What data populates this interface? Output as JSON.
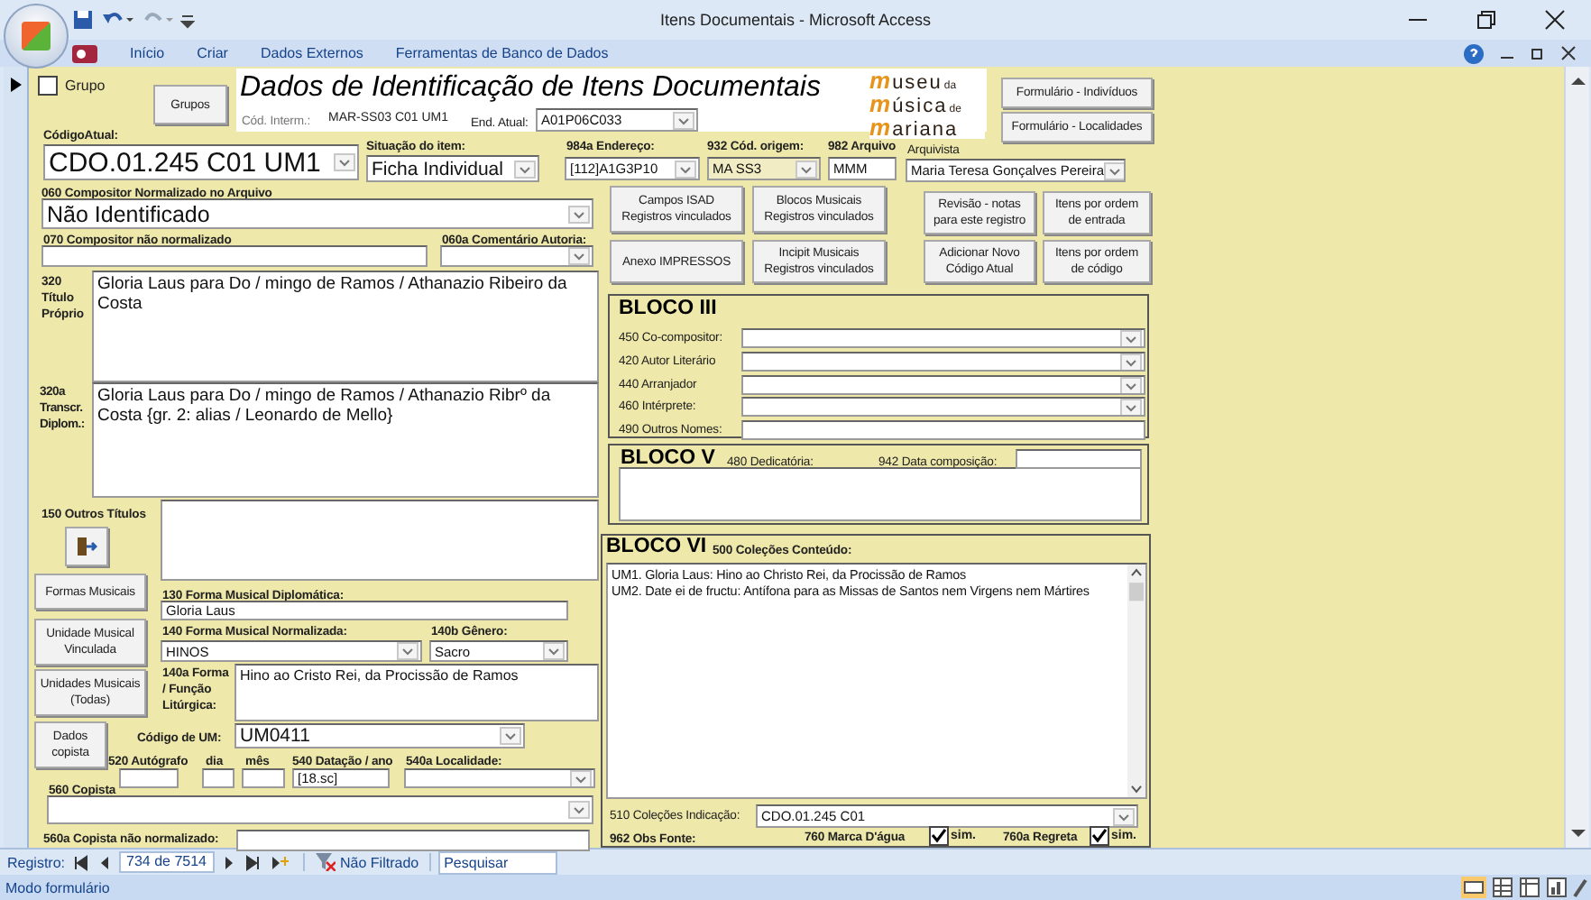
{
  "window": {
    "title": "Itens Documentais - Microsoft Access"
  },
  "ribbon_tabs": [
    "Início",
    "Criar",
    "Dados Externos",
    "Ferramentas de Banco de Dados"
  ],
  "form": {
    "title": "Dados de Identificação de Itens Documentais",
    "grupo": {
      "label": "Grupo",
      "checked": false
    },
    "logo": [
      {
        "word": "museu",
        "small": "da"
      },
      {
        "word": "música",
        "small": "de"
      },
      {
        "word": "mariana"
      }
    ],
    "buttons": [
      "Grupos",
      "Formulário - Indivíduos",
      "Formulário - Localidades",
      "Campos ISAD Registros vinculados",
      "Blocos Musicais Registros vinculados",
      "Anexo IMPRESSOS",
      "Incipit Musicais Registros vinculados",
      "Revisão - notas para este registro",
      "Itens por ordem de entrada",
      "Adicionar Novo Código Atual",
      "Itens por ordem de código",
      "Formas Musicais",
      "Unidade Musical Vinculada",
      "Unidades Musicais (Todas)",
      "Dados copista"
    ],
    "blocks": [
      "BLOCO III",
      "BLOCO V",
      "BLOCO VI"
    ],
    "fields": [
      {
        "label": "CódigoAtual:",
        "kind": "combo",
        "value": "CDO.01.245 C01 UM1"
      },
      {
        "label": "Situação do item:",
        "kind": "combo",
        "value": "Ficha Individual"
      },
      {
        "label": "984a Endereço:",
        "kind": "combo",
        "value": "[112]A1G3P10"
      },
      {
        "label": "932 Cód. origem:",
        "kind": "combo",
        "value": "MA SS3"
      },
      {
        "label": "982 Arquivo",
        "kind": "text",
        "value": "MMM"
      },
      {
        "label": "Arquivista",
        "kind": "combo",
        "value": "Maria Teresa Gonçalves Pereira"
      },
      {
        "label": "060 Compositor Normalizado no Arquivo",
        "kind": "combo",
        "value": "Não Identificado"
      },
      {
        "label": "070 Compositor não normalizado",
        "kind": "text"
      },
      {
        "label": "060a Comentário Autoria:",
        "kind": "combo"
      },
      {
        "label": "320 Título Próprio",
        "kind": "textarea",
        "value": "Gloria Laus para Do / mingo de Ramos / Athanazio Ribeiro da Costa"
      },
      {
        "label": "320a Transcr. Diplom.:",
        "kind": "textarea",
        "value": "Gloria Laus para Do / mingo de Ramos / Athanazio Ribrº da Costa {gr. 2: alias / Leonardo de Mello}"
      },
      {
        "label": "150 Outros Títulos",
        "kind": "textarea"
      },
      {
        "label": "130 Forma Musical Diplomática:",
        "kind": "text",
        "value": "Gloria Laus"
      },
      {
        "label": "140 Forma Musical Normalizada:",
        "kind": "combo",
        "value": "HINOS"
      },
      {
        "label": "140b Gênero:",
        "kind": "combo",
        "value": "Sacro"
      },
      {
        "label": "140a Forma / Função Litúrgica:",
        "kind": "textarea",
        "value": "Hino ao Cristo Rei, da Procissão de Ramos"
      },
      {
        "label": "Código de UM:",
        "kind": "combo",
        "value": "UM0411"
      },
      {
        "label": "520 Autógrafo",
        "kind": "text"
      },
      {
        "label": "dia",
        "kind": "text"
      },
      {
        "label": "mês",
        "kind": "text"
      },
      {
        "label": "540 Datação / ano",
        "kind": "text",
        "value": "[18.sc]"
      },
      {
        "label": "540a Localidade:",
        "kind": "combo"
      },
      {
        "label": "560 Copista",
        "kind": "combo"
      },
      {
        "label": "560a Copista não normalizado:",
        "kind": "text"
      },
      {
        "label": "Cód. Interm.:",
        "kind": "plain",
        "value": "MAR-SS03 C01 UM1"
      },
      {
        "label": "End. Atual:",
        "kind": "combo",
        "value": "A01P06C033"
      },
      {
        "label": "450 Co-compositor:",
        "kind": "combo"
      },
      {
        "label": "420 Autor Literário",
        "kind": "combo"
      },
      {
        "label": "440 Arranjador",
        "kind": "combo"
      },
      {
        "label": "460 Intérprete:",
        "kind": "combo"
      },
      {
        "label": "490 Outros Nomes:",
        "kind": "text"
      },
      {
        "label": "480 Dedicatória:",
        "kind": "textarea"
      },
      {
        "label": "942 Data composição:",
        "kind": "text"
      },
      {
        "label": "500 Coleções Conteúdo:",
        "kind": "scrolltext",
        "value": "UM1. Gloria Laus: Hino ao Christo Rei, da Procissão de Ramos\nUM2. Date ei de fructu: Antífona para as Missas de Santos nem Virgens nem Mártires"
      },
      {
        "label": "510  Coleções Indicação:",
        "kind": "combo",
        "value": "CDO.01.245 C01"
      },
      {
        "label": "962 Obs Fonte:",
        "kind": "label"
      },
      {
        "label": "760 Marca D'água",
        "kind": "checkbox",
        "checked": true,
        "caption": "sim."
      },
      {
        "label": "760a Regreta",
        "kind": "checkbox",
        "checked": true,
        "caption": "sim."
      }
    ]
  },
  "navigation": {
    "label": "Registro:",
    "record": "734 de 7514",
    "filter": "Não Filtrado",
    "search": {
      "placeholder": "Pesquisar"
    }
  },
  "status_bar": {
    "mode": "Modo formulário"
  }
}
